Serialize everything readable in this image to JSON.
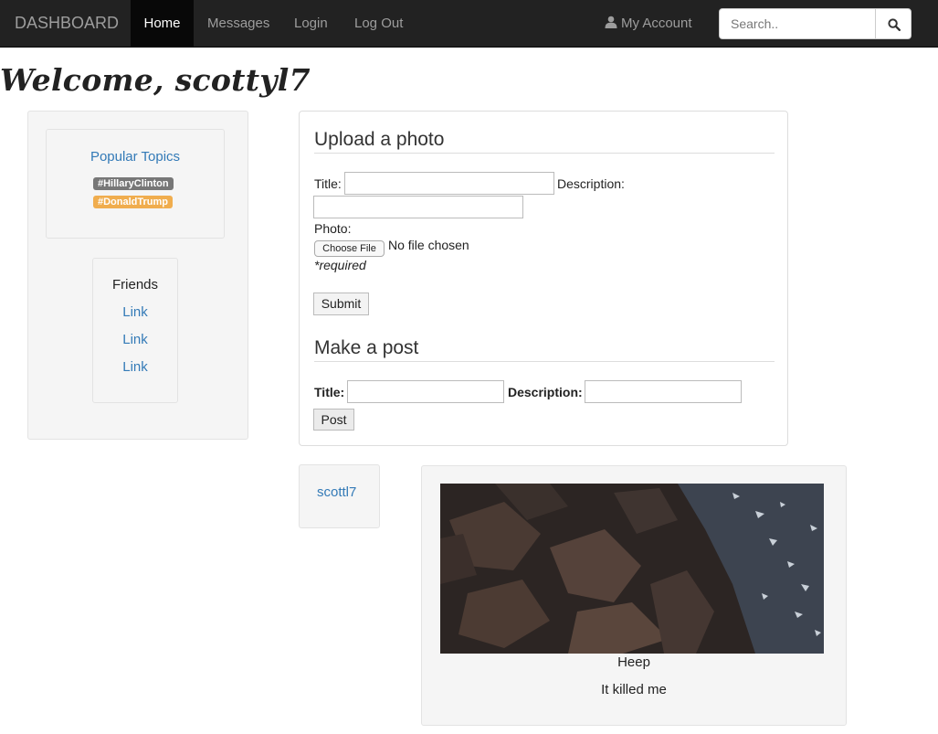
{
  "navbar": {
    "brand": "DASHBOARD",
    "items": [
      "Home",
      "Messages",
      "Login",
      "Log Out"
    ],
    "account": "My Account",
    "search_placeholder": "Search.."
  },
  "welcome": "Welcome, scottyl7",
  "sidebar": {
    "topics_title": "Popular Topics",
    "tags": [
      {
        "label": "#HillaryClinton",
        "color": "#777777"
      },
      {
        "label": "#DonaldTrump",
        "color": "#f0ad4e"
      }
    ],
    "friends_title": "Friends",
    "friends": [
      "Link",
      "Link",
      "Link"
    ]
  },
  "upload": {
    "heading": "Upload a photo",
    "title_label": "Title:",
    "description_label": "Description:",
    "photo_label": "Photo:",
    "choose_file": "Choose File",
    "no_file": "No file chosen",
    "required": "*required",
    "submit": "Submit"
  },
  "post_form": {
    "heading": "Make a post",
    "title_label": "Title:",
    "description_label": "Description:",
    "post_button": "Post"
  },
  "feed": {
    "username": "scottl7",
    "post_title": "Heep",
    "post_description": "It killed me"
  },
  "colors": {
    "navbar": "#222222",
    "link": "#337ab7",
    "panel": "#f5f5f5"
  }
}
